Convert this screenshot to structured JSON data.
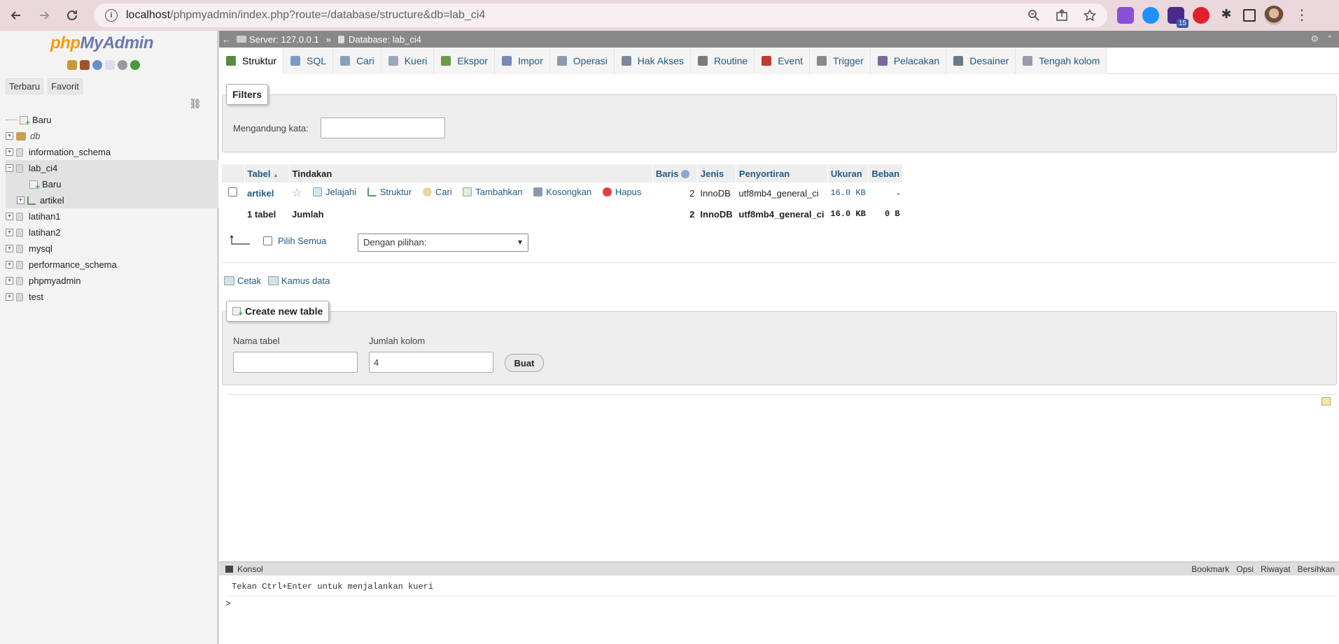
{
  "browser": {
    "url_host": "localhost",
    "url_path": "/phpmyadmin/index.php?route=/database/structure&db=lab_ci4",
    "extension_badge": "15"
  },
  "nav": {
    "logo_php": "php",
    "logo_myadmin": "MyAdmin",
    "tab_recent": "Terbaru",
    "tab_favorite": "Favorit",
    "tree": [
      {
        "label": "Baru",
        "type": "new"
      },
      {
        "label": "db",
        "type": "db"
      },
      {
        "label": "information_schema",
        "type": "db"
      },
      {
        "label": "lab_ci4",
        "type": "db-open"
      },
      {
        "label": "Baru",
        "type": "child-new"
      },
      {
        "label": "artikel",
        "type": "child-table"
      },
      {
        "label": "latihan1",
        "type": "db"
      },
      {
        "label": "latihan2",
        "type": "db"
      },
      {
        "label": "mysql",
        "type": "db"
      },
      {
        "label": "performance_schema",
        "type": "db"
      },
      {
        "label": "phpmyadmin",
        "type": "db"
      },
      {
        "label": "test",
        "type": "db"
      }
    ]
  },
  "breadcrumb": {
    "server": "Server: 127.0.0.1",
    "separator": "»",
    "database": "Database: lab_ci4"
  },
  "tabs": [
    {
      "label": "Struktur",
      "color": "#5a8a3c"
    },
    {
      "label": "SQL",
      "color": "#7a9cc6"
    },
    {
      "label": "Cari",
      "color": "#8aa0b8"
    },
    {
      "label": "Kueri",
      "color": "#9aa8b8"
    },
    {
      "label": "Ekspor",
      "color": "#6a9a4a"
    },
    {
      "label": "Impor",
      "color": "#7a8ab8"
    },
    {
      "label": "Operasi",
      "color": "#8a9aaa"
    },
    {
      "label": "Hak Akses",
      "color": "#7a8a9a"
    },
    {
      "label": "Routine",
      "color": "#7a7a7a"
    },
    {
      "label": "Event",
      "color": "#c0392b"
    },
    {
      "label": "Trigger",
      "color": "#8a8a8a"
    },
    {
      "label": "Pelacakan",
      "color": "#7a6a9a"
    },
    {
      "label": "Desainer",
      "color": "#6a7a8a"
    },
    {
      "label": "Tengah kolom",
      "color": "#9a9aaa"
    }
  ],
  "filters": {
    "legend": "Filters",
    "label": "Mengandung kata:",
    "value": ""
  },
  "table": {
    "headers": {
      "tabel": "Tabel",
      "sort_arrow": "▲",
      "tindakan": "Tindakan",
      "baris": "Baris",
      "jenis": "Jenis",
      "penyortiran": "Penyortiran",
      "ukuran": "Ukuran",
      "beban": "Beban"
    },
    "row": {
      "name": "artikel",
      "actions": {
        "browse": "Jelajahi",
        "structure": "Struktur",
        "search": "Cari",
        "insert": "Tambahkan",
        "empty": "Kosongkan",
        "drop": "Hapus"
      },
      "rows": "2",
      "engine": "InnoDB",
      "collation": "utf8mb4_general_ci",
      "size": "16.0 KB",
      "overhead": "-"
    },
    "footer": {
      "count": "1 tabel",
      "sum_label": "Jumlah",
      "rows": "2",
      "engine": "InnoDB",
      "collation": "utf8mb4_general_ci",
      "size": "16.0 KB",
      "overhead": "0 B"
    },
    "select_all": "Pilih Semua",
    "with_selected": "Dengan pilihan:"
  },
  "links": {
    "print": "Cetak",
    "data_dictionary": "Kamus data"
  },
  "create_table": {
    "legend": "Create new table",
    "name_label": "Nama tabel",
    "name_value": "",
    "cols_label": "Jumlah kolom",
    "cols_value": "4",
    "button": "Buat"
  },
  "console": {
    "title": "Konsol",
    "bookmark": "Bookmark",
    "options": "Opsi",
    "history": "Riwayat",
    "clear": "Bersihkan",
    "hint": "Tekan Ctrl+Enter untuk menjalankan kueri",
    "prompt": ">"
  }
}
